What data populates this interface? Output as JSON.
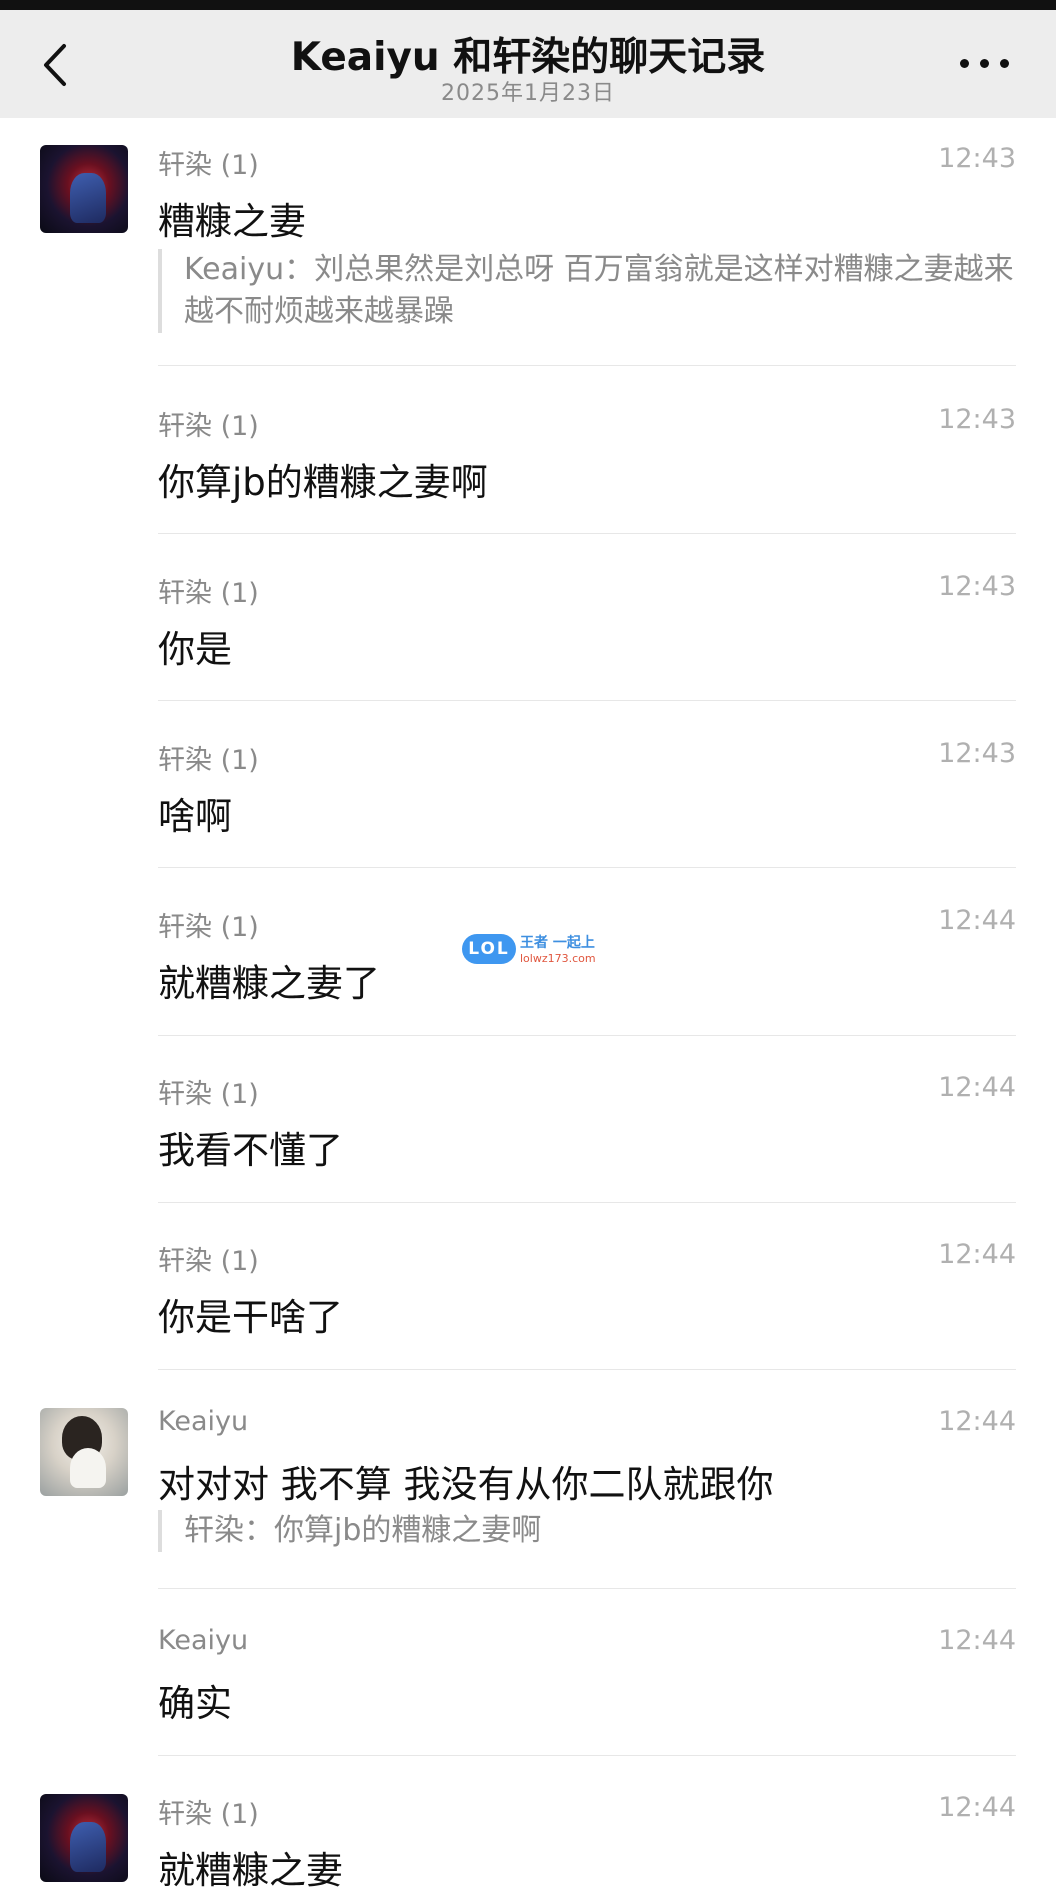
{
  "header": {
    "title": "Keaiyu 和轩染的聊天记录",
    "subtitle": "2025年1月23日",
    "back_icon": "chevron-left-icon",
    "more_icon": "more-horizontal-icon"
  },
  "watermark": {
    "badge": "LOL",
    "text": "王者 一起上",
    "url": "lolwz173.com"
  },
  "messages": [
    {
      "sender": "轩染 (1)",
      "time": "12:43",
      "text": "糟糠之妻",
      "quote": "Keaiyu：刘总果然是刘总呀 百万富翁就是这样对糟糠之妻越来越不耐烦越来越暴躁",
      "avatar": "avatar-xuanran"
    },
    {
      "sender": "轩染 (1)",
      "time": "12:43",
      "text": "你算jb的糟糠之妻啊"
    },
    {
      "sender": "轩染 (1)",
      "time": "12:43",
      "text": "你是"
    },
    {
      "sender": "轩染 (1)",
      "time": "12:43",
      "text": "啥啊"
    },
    {
      "sender": "轩染 (1)",
      "time": "12:44",
      "text": "就糟糠之妻了"
    },
    {
      "sender": "轩染 (1)",
      "time": "12:44",
      "text": "我看不懂了"
    },
    {
      "sender": "轩染 (1)",
      "time": "12:44",
      "text": "你是干啥了"
    },
    {
      "sender": "Keaiyu",
      "time": "12:44",
      "text": "对对对 我不算 我没有从你二队就跟你",
      "quote": "轩染：你算jb的糟糠之妻啊",
      "avatar": "avatar-keaiyu"
    },
    {
      "sender": "Keaiyu",
      "time": "12:44",
      "text": "确实"
    },
    {
      "sender": "轩染 (1)",
      "time": "12:44",
      "text": "就糟糠之妻",
      "avatar": "avatar-xuanran"
    }
  ]
}
